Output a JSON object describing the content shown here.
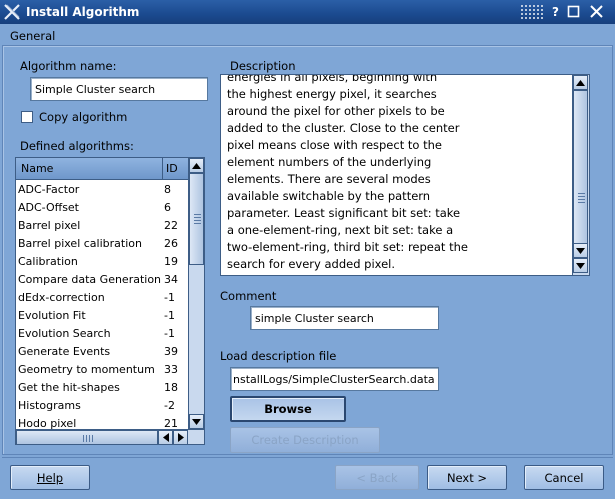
{
  "window": {
    "title": "Install Algorithm"
  },
  "section": {
    "label": "General"
  },
  "algorithm": {
    "name_label": "Algorithm name:",
    "name_value": "Simple Cluster search",
    "copy_label": "Copy algorithm",
    "copy_checked": false
  },
  "defined": {
    "label": "Defined algorithms:",
    "columns": [
      "Name",
      "ID"
    ],
    "rows": [
      {
        "name": "ADC-Factor",
        "id": "8"
      },
      {
        "name": "ADC-Offset",
        "id": "6"
      },
      {
        "name": "Barrel pixel",
        "id": "22"
      },
      {
        "name": "Barrel pixel calibration",
        "id": "26"
      },
      {
        "name": "Calibration",
        "id": "19"
      },
      {
        "name": "Compare data Generation",
        "id": "34"
      },
      {
        "name": "dEdx-correction",
        "id": "-1"
      },
      {
        "name": "Evolution Fit",
        "id": "-1"
      },
      {
        "name": "Evolution Search",
        "id": "-1"
      },
      {
        "name": "Generate Events",
        "id": "39"
      },
      {
        "name": "Geometry to momentum",
        "id": "33"
      },
      {
        "name": "Get the hit-shapes",
        "id": "18"
      },
      {
        "name": "Histograms",
        "id": "-2"
      },
      {
        "name": "Hodo pixel",
        "id": "21"
      }
    ]
  },
  "description": {
    "label": "Description",
    "text": "energies in all pixels, beginning with\nthe highest energy pixel, it searches\naround the pixel for other pixels to be\nadded to the cluster. Close to the center\npixel means close with respect to the\nelement numbers of the underlying\nelements. There are several modes\navailable switchable by the pattern\nparameter. Least significant bit set: take\na one-element-ring, next bit set: take a\ntwo-element-ring, third bit set: repeat the\nsearch for every added pixel."
  },
  "comment": {
    "label": "Comment",
    "value": "simple Cluster search"
  },
  "load": {
    "label": "Load description file",
    "value": "nstallLogs/SimpleClusterSearch.data",
    "browse_label": "Browse",
    "create_label": "Create Description"
  },
  "footer": {
    "help_label": "Help",
    "back_label": "< Back",
    "next_label": "Next >",
    "cancel_label": "Cancel"
  },
  "icons": {
    "window": "x-logo-icon",
    "help": "question-icon",
    "minimize": "minimize-icon",
    "maximize": "maximize-icon",
    "close": "close-icon"
  },
  "colors": {
    "window_bg": "#7fa6d6",
    "titlebar": "#1b4a8f",
    "button": "#b3cceb"
  }
}
